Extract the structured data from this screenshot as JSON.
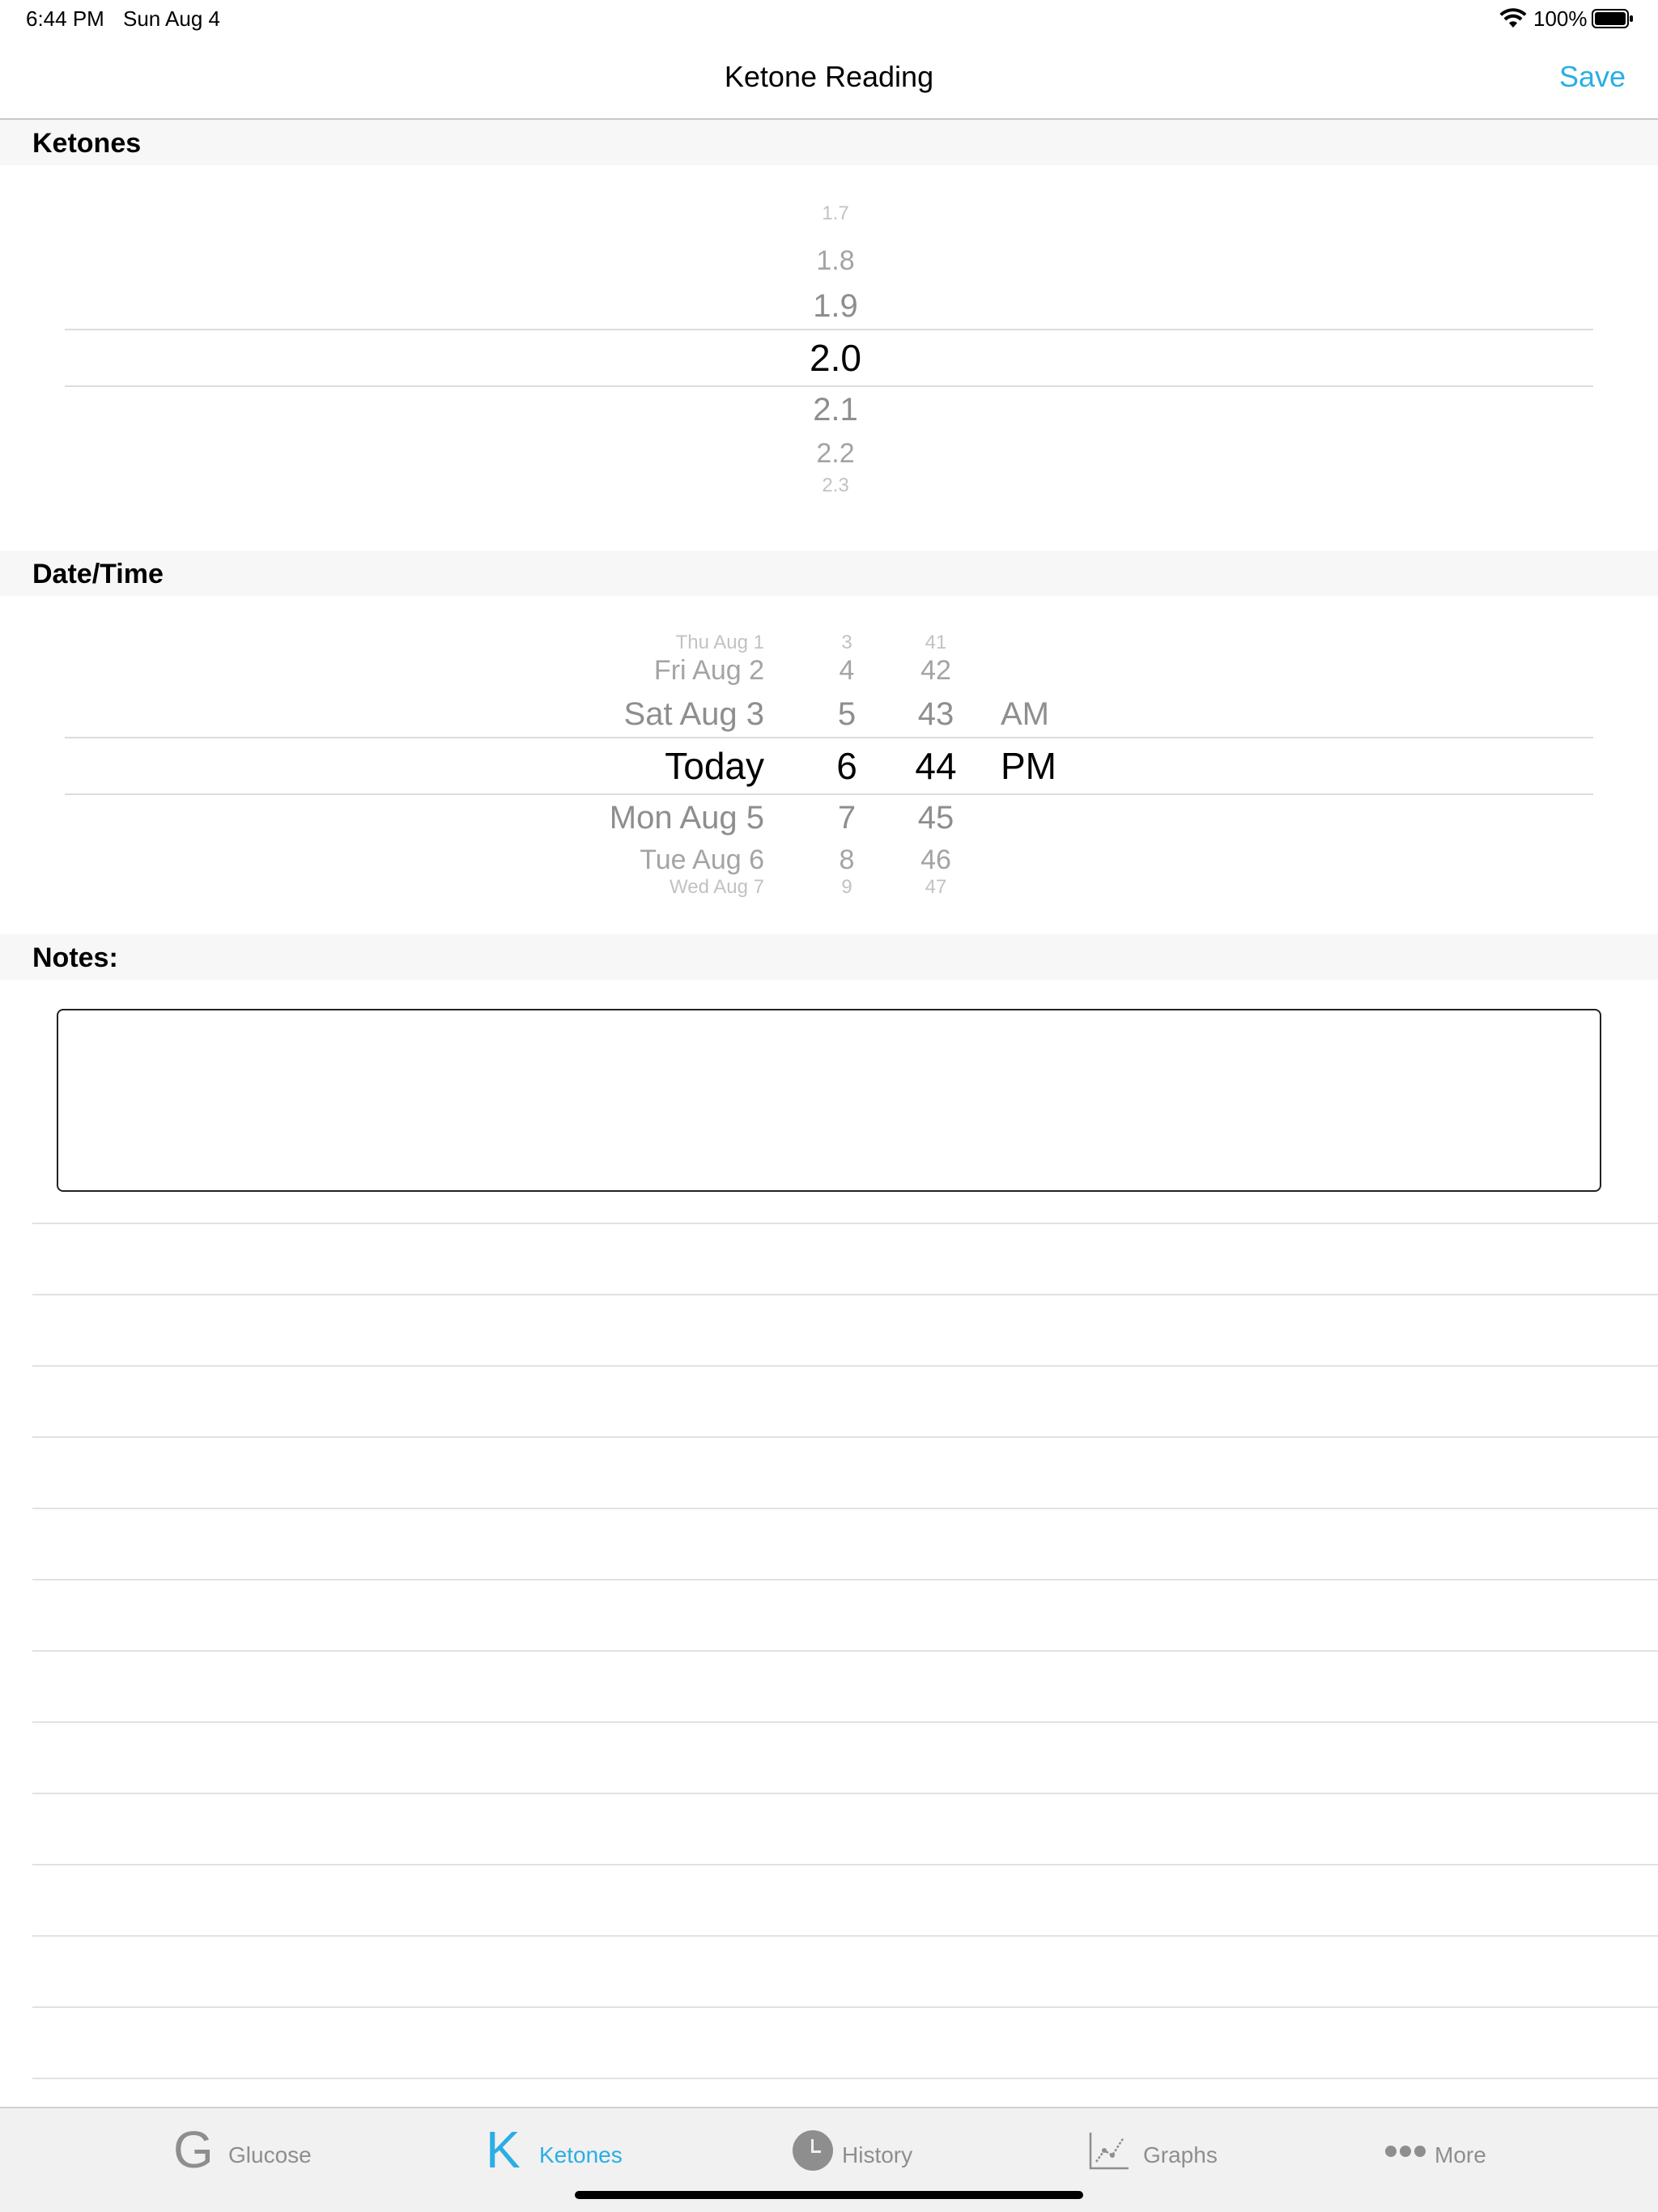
{
  "status_bar": {
    "time": "6:44 PM",
    "date": "Sun Aug 4",
    "battery_pct": "100%",
    "icons": [
      "wifi-icon",
      "battery-icon"
    ]
  },
  "nav": {
    "title": "Ketone Reading",
    "save_label": "Save"
  },
  "sections": {
    "ketones": "Ketones",
    "datetime": "Date/Time",
    "notes": "Notes:"
  },
  "ketone_picker": {
    "values": [
      "1.7",
      "1.8",
      "1.9",
      "2.0",
      "2.1",
      "2.2",
      "2.3"
    ],
    "selected": "2.0"
  },
  "datetime_picker": {
    "days": [
      "Thu Aug 1",
      "Fri Aug 2",
      "Sat Aug 3",
      "Today",
      "Mon Aug 5",
      "Tue Aug 6",
      "Wed Aug 7"
    ],
    "hours": [
      "3",
      "4",
      "5",
      "6",
      "7",
      "8",
      "9"
    ],
    "minutes": [
      "41",
      "42",
      "43",
      "44",
      "45",
      "46",
      "47"
    ],
    "ampm": [
      "AM",
      "PM"
    ],
    "selected": {
      "day": "Today",
      "hour": "6",
      "minute": "44",
      "ampm": "PM"
    }
  },
  "notes": {
    "value": ""
  },
  "tab_bar": {
    "tabs": [
      {
        "label": "Glucose",
        "icon": "glucose-g-icon",
        "glyph": "G"
      },
      {
        "label": "Ketones",
        "icon": "ketones-k-icon",
        "glyph": "K"
      },
      {
        "label": "History",
        "icon": "clock-icon"
      },
      {
        "label": "Graphs",
        "icon": "line-graph-icon"
      },
      {
        "label": "More",
        "icon": "more-dots-icon"
      }
    ],
    "active": "Ketones"
  },
  "colors": {
    "accent": "#2aaee5",
    "inactive": "#8e8e8e",
    "section_bg": "#f7f7f7"
  }
}
